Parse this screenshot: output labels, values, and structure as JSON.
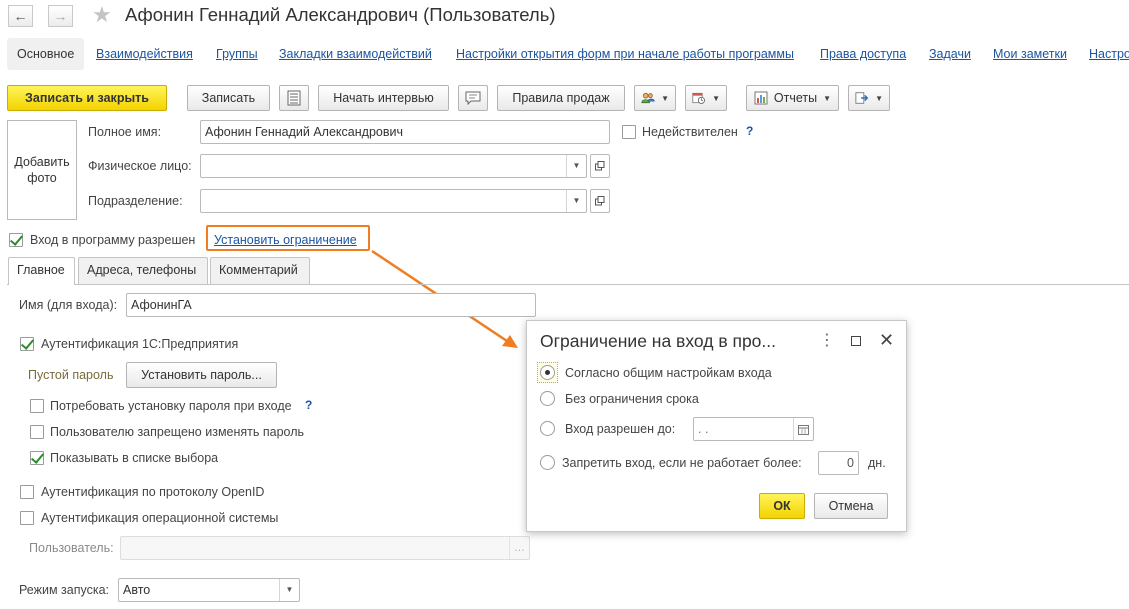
{
  "window": {
    "title": "Афонин Геннадий Александрович (Пользователь)"
  },
  "nav": {
    "active": "Основное",
    "links": [
      "Взаимодействия",
      "Группы",
      "Закладки взаимодействий",
      "Настройки открытия форм при начале работы программы",
      "Права доступа",
      "Задачи",
      "Мои заметки",
      "Настро"
    ]
  },
  "toolbar": {
    "save_close": "Записать и закрыть",
    "save": "Записать",
    "interview": "Начать интервью",
    "sales_rules": "Правила продаж",
    "reports": "Отчеты"
  },
  "photo": {
    "label_line1": "Добавить",
    "label_line2": "фото"
  },
  "fields": {
    "full_name_label": "Полное имя:",
    "full_name_value": "Афонин Геннадий Александрович",
    "inactive_label": "Недействителен",
    "individual_label": "Физическое лицо:",
    "individual_value": "",
    "department_label": "Подразделение:",
    "department_value": ""
  },
  "login": {
    "allowed_label": "Вход в программу разрешен",
    "allowed_checked": true,
    "set_restriction_link": "Установить ограничение"
  },
  "tabs": [
    "Главное",
    "Адреса, телефоны",
    "Комментарий"
  ],
  "main_tab": {
    "login_name_label": "Имя (для входа):",
    "login_name_value": "АфонинГА",
    "auth_1c_label": "Аутентификация 1С:Предприятия",
    "empty_password_label": "Пустой пароль",
    "set_password_button": "Установить пароль...",
    "require_password_label": "Потребовать установку пароля при входе",
    "forbid_change_label": "Пользователю запрещено изменять пароль",
    "show_in_list_label": "Показывать в списке выбора",
    "openid_label": "Аутентификация по протоколу OpenID",
    "os_auth_label": "Аутентификация операционной системы",
    "os_user_label": "Пользователь:",
    "os_user_value": "",
    "launch_mode_label": "Режим запуска:",
    "launch_mode_value": "Авто"
  },
  "dialog": {
    "title": "Ограничение на вход в про...",
    "options": [
      "Согласно общим настройкам входа",
      "Без ограничения срока",
      "Вход разрешен до:",
      "Запретить вход, если не работает более:"
    ],
    "selected_option": 0,
    "date_value": " .  .",
    "days_value": "0",
    "days_unit": "дн.",
    "ok_button": "ОК",
    "cancel_button": "Отмена"
  },
  "colors": {
    "accent_yellow": "#f3d400",
    "link_blue": "#1c55a0",
    "annotation_orange": "#f07d1f",
    "check_green": "#2d8a2d"
  }
}
